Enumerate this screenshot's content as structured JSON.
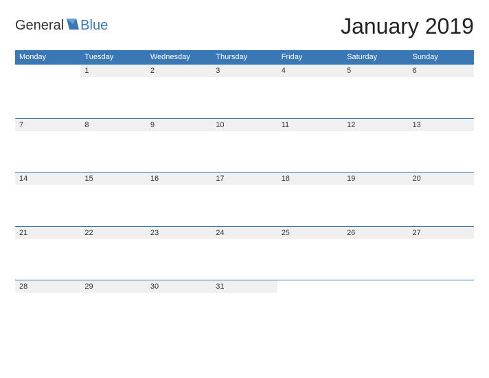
{
  "logo": {
    "text_dark": "General",
    "text_blue": "Blue"
  },
  "title": "January 2019",
  "weekdays": [
    "Monday",
    "Tuesday",
    "Wednesday",
    "Thursday",
    "Friday",
    "Saturday",
    "Sunday"
  ],
  "weeks": [
    [
      "",
      "1",
      "2",
      "3",
      "4",
      "5",
      "6"
    ],
    [
      "7",
      "8",
      "9",
      "10",
      "11",
      "12",
      "13"
    ],
    [
      "14",
      "15",
      "16",
      "17",
      "18",
      "19",
      "20"
    ],
    [
      "21",
      "22",
      "23",
      "24",
      "25",
      "26",
      "27"
    ],
    [
      "28",
      "29",
      "30",
      "31",
      "",
      "",
      ""
    ]
  ]
}
